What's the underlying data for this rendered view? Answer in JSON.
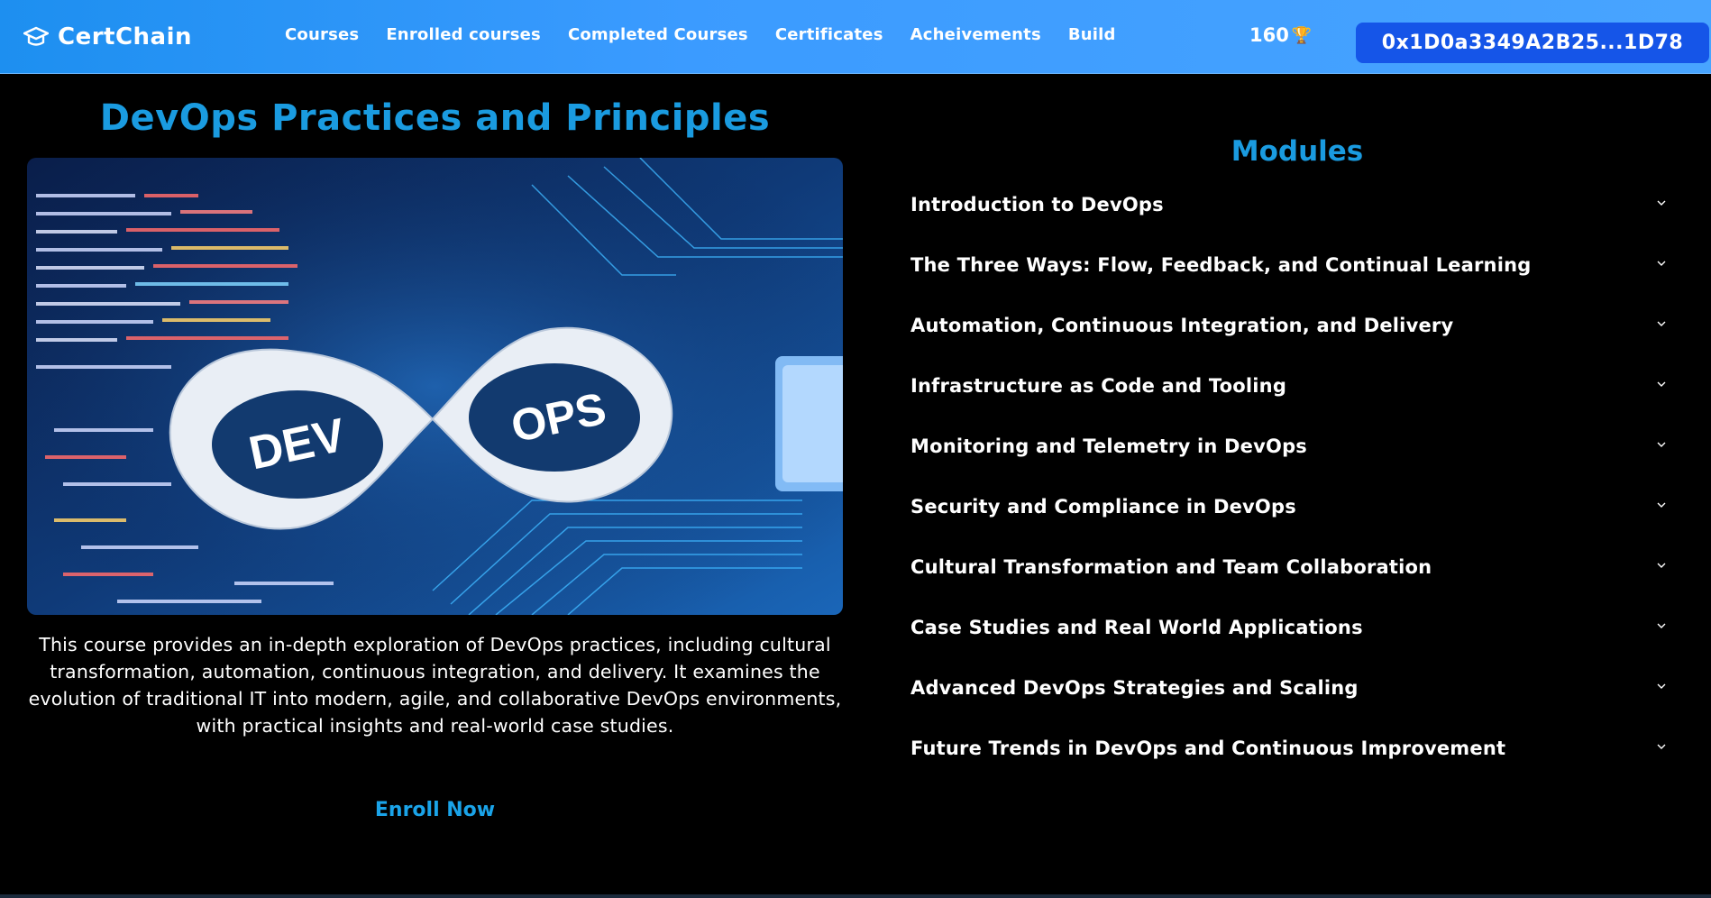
{
  "brand": {
    "name": "CertChain",
    "icon": "graduation-cap-icon"
  },
  "nav": {
    "links": [
      "Courses",
      "Enrolled courses",
      "Completed Courses",
      "Certificates",
      "Acheivements",
      "Build"
    ],
    "points": "160",
    "points_icon": "trophy-icon",
    "wallet": "0x1D0a3349A2B25...1D78"
  },
  "course": {
    "title": "DevOps Practices and Principles",
    "image_text": {
      "left": "DEV",
      "right": "OPS"
    },
    "description": "This course provides an in-depth exploration of DevOps practices, including cultural transformation, automation, continuous integration, and delivery. It examines the evolution of traditional IT into modern, agile, and collaborative DevOps environments, with practical insights and real-world case studies.",
    "enroll_label": "Enroll Now"
  },
  "modules": {
    "heading": "Modules",
    "items": [
      "Introduction to DevOps",
      "The Three Ways: Flow, Feedback, and Continual Learning",
      "Automation, Continuous Integration, and Delivery",
      "Infrastructure as Code and Tooling",
      "Monitoring and Telemetry in DevOps",
      "Security and Compliance in DevOps",
      "Cultural Transformation and Team Collaboration",
      "Case Studies and Real World Applications",
      "Advanced DevOps Strategies and Scaling",
      "Future Trends in DevOps and Continuous Improvement"
    ]
  },
  "colors": {
    "accent": "#1a9be0",
    "navbar": "#3b9bff",
    "wallet_bg": "#1555e8",
    "background": "#000000"
  }
}
